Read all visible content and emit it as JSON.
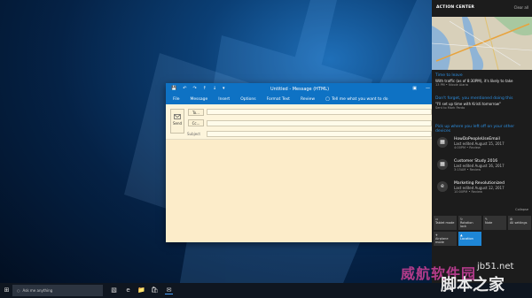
{
  "window": {
    "title": "Untitled - Message (HTML)",
    "ribbon": [
      "File",
      "Message",
      "Insert",
      "Options",
      "Format Text",
      "Review"
    ],
    "tell_me": "Tell me what you want to do",
    "send_label": "Send",
    "to_label": "To...",
    "cc_label": "Cc...",
    "subject_label": "Subject"
  },
  "action_center": {
    "header": "ACTION CENTER",
    "clear_all": "Clear all",
    "notifications": [
      {
        "heading": "Time to leave",
        "line": "With traffic (as of 8:30PM), it's likely to take",
        "sub": "13 PM • Nicole Alaria"
      },
      {
        "heading": "Don't forget, you mentioned doing this",
        "line": "\"I'll set up time with Kristi tomorrow\"",
        "sub": "Sent to Mark Pardo"
      }
    ],
    "pick_up": "Pick up where you left off on your other devices",
    "docs": [
      {
        "title": "HowDoPeopleUseEmail",
        "date": "Last edited August 15, 2017",
        "meta": "4:00PM • Review",
        "icon": "doc-icon"
      },
      {
        "title": "Customer Study 2016",
        "date": "Last edited August 16, 2017",
        "meta": "3:15AM • Review",
        "icon": "doc-icon"
      },
      {
        "title": "Marketing Revolutionized",
        "date": "Last edited August 12, 2017",
        "meta": "10:00PM • Review",
        "icon": "edge-icon"
      }
    ],
    "collapse": "Collapse",
    "tiles": [
      "Tablet mode",
      "Rotation lock",
      "Note",
      "All settings",
      "Airplane mode",
      "Location"
    ]
  },
  "taskbar": {
    "search_placeholder": "Ask me anything"
  },
  "watermark": {
    "left": "威航软件园",
    "right": "jb51.net",
    "bottom": "脚本之家"
  },
  "colors": {
    "accent": "#0e72c4",
    "action_center_bg": "#1c1c1c",
    "compose_bg": "#fcecc9",
    "tile_active": "#1e86d6"
  }
}
